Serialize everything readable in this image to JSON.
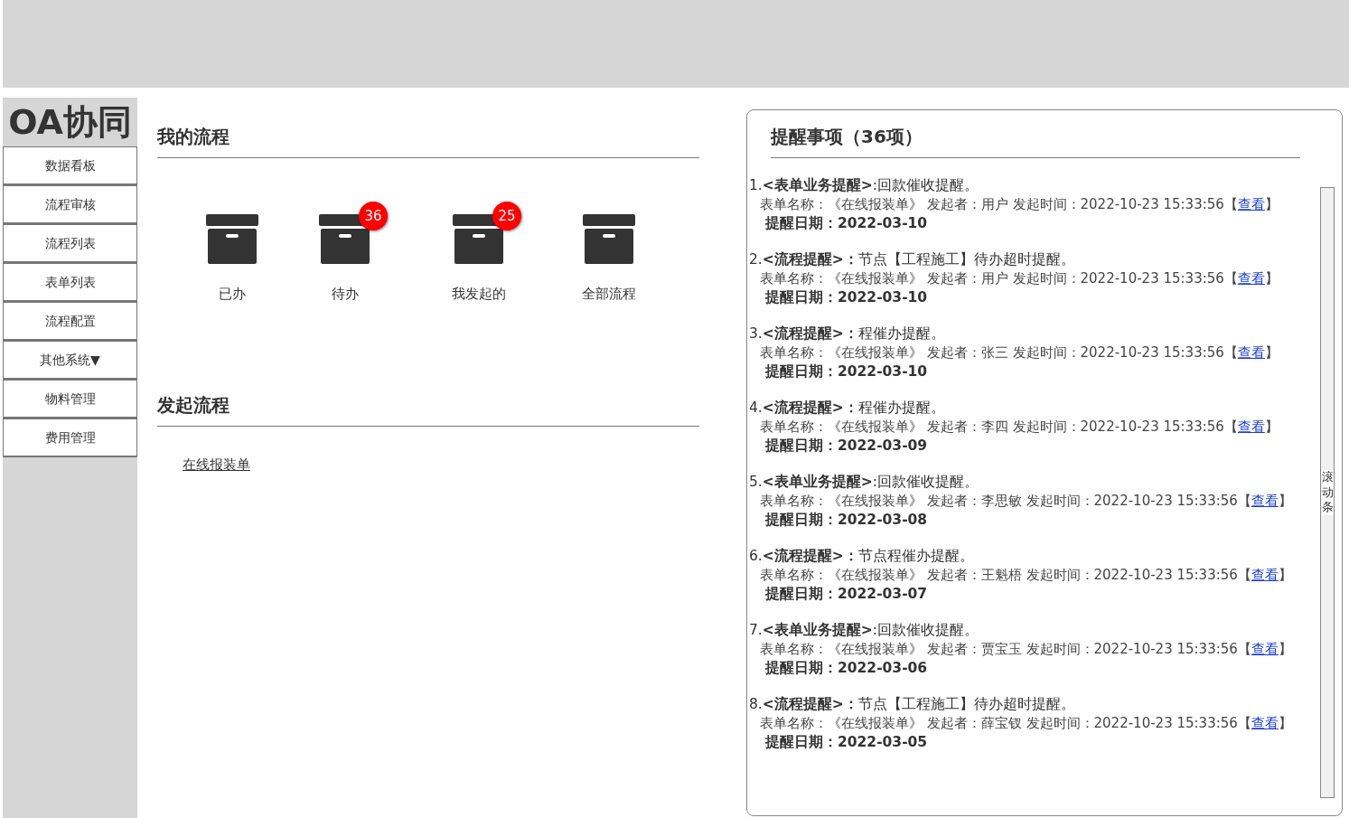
{
  "logo": "OA协同",
  "sidebar": {
    "items": [
      {
        "label": "数据看板"
      },
      {
        "label": "流程审核"
      },
      {
        "label": "流程列表"
      },
      {
        "label": "表单列表"
      },
      {
        "label": "流程配置"
      },
      {
        "label": "其他系统▼"
      },
      {
        "label": "物料管理"
      },
      {
        "label": "费用管理"
      }
    ]
  },
  "my_flows": {
    "title": "我的流程",
    "items": [
      {
        "label": "已办"
      },
      {
        "label": "待办",
        "badge": "36"
      },
      {
        "label": "我发起的",
        "badge": "25"
      },
      {
        "label": "全部流程"
      }
    ]
  },
  "start_flows": {
    "title": "发起流程",
    "links": [
      "在线报装单"
    ]
  },
  "reminders": {
    "title": "提醒事项（36项）",
    "scrollbar_label": "滚动条",
    "items": [
      {
        "heading": "1.**<表单业务提醒>**:回款催收提醒。",
        "detail": "表单名称：《在线报装单》 发起者：用户  发起时间：2022-10-23 15:33:56【",
        "link": "查看",
        "detail_end": "】",
        "date": "提醒日期：2022-03-10"
      },
      {
        "heading": "2.**<流程提醒>：**节点【工程施工】待办超时提醒。",
        "detail": "表单名称：《在线报装单》 发起者：用户  发起时间：2022-10-23 15:33:56【",
        "link": "查看",
        "detail_end": "】",
        "date": "提醒日期：2022-03-10"
      },
      {
        "heading": "3.**<流程提醒>：**程催办提醒。",
        "detail": "表单名称：《在线报装单》 发起者：张三  发起时间：2022-10-23 15:33:56【",
        "link": "查看",
        "detail_end": "】",
        "date": "提醒日期：2022-03-10"
      },
      {
        "heading": "4.**<流程提醒>：**程催办提醒。",
        "detail": "表单名称：《在线报装单》 发起者：李四  发起时间：2022-10-23 15:33:56【",
        "link": "查看",
        "detail_end": "】",
        "date": "提醒日期：2022-03-09"
      },
      {
        "heading": "5.**<表单业务提醒>**:回款催收提醒。",
        "detail": "表单名称：《在线报装单》 发起者：李思敏  发起时间：2022-10-23 15:33:56【",
        "link": "查看",
        "detail_end": "】",
        "date": "提醒日期：2022-03-08"
      },
      {
        "heading": "6.**<流程提醒>：**节点程催办提醒。",
        "detail": "表单名称：《在线报装单》 发起者：王魁梧  发起时间：2022-10-23 15:33:56【",
        "link": "查看",
        "detail_end": "】",
        "date": "提醒日期：2022-03-07"
      },
      {
        "heading": "7.**<表单业务提醒>**:回款催收提醒。",
        "detail": "表单名称：《在线报装单》 发起者：贾宝玉 发起时间：2022-10-23 15:33:56【",
        "link": "查看",
        "detail_end": "】",
        "date": "提醒日期：2022-03-06"
      },
      {
        "heading": "8.**<流程提醒>：**节点【工程施工】待办超时提醒。",
        "detail": "表单名称：《在线报装单》 发起者：薛宝钗  发起时间：2022-10-23 15:33:56【",
        "link": "查看",
        "detail_end": "】",
        "date": "提醒日期：2022-03-05"
      }
    ]
  }
}
